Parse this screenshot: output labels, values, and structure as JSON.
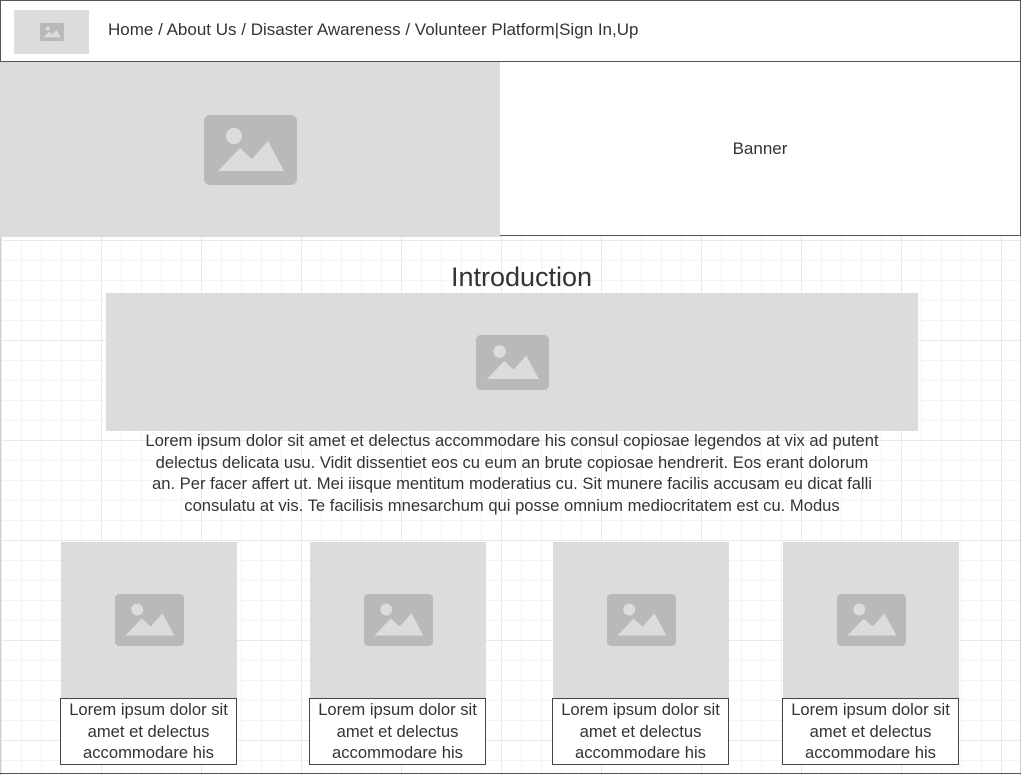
{
  "header": {
    "nav": {
      "home": "Home",
      "sep1": " / ",
      "about": "About Us",
      "sep2": " / ",
      "disaster": "Disaster Awareness",
      "sep3": " / ",
      "volunteer": "Volunteer Platform",
      "sep4": "|",
      "signin": "Sign In,Up"
    },
    "logo_icon": "image-placeholder-icon"
  },
  "banner": {
    "label": "Banner",
    "image_icon": "image-placeholder-icon"
  },
  "intro": {
    "title": "Introduction",
    "image_icon": "image-placeholder-icon",
    "lines": [
      "Lorem ipsum dolor sit amet et delectus accommodare his consul copiosae legendos at vix ad putent",
      "delectus delicata usu. Vidit dissentiet eos cu eum an brute copiosae hendrerit. Eos erant dolorum",
      "an. Per facer affert ut. Mei iisque mentitum moderatius cu. Sit munere facilis accusam eu dicat falli",
      "consulatu at vis. Te facilisis mnesarchum qui posse omnium mediocritatem est cu. Modus"
    ]
  },
  "cards": [
    {
      "line1": "Lorem ipsum dolor sit",
      "line2": "amet et delectus",
      "line3": "accommodare his"
    },
    {
      "line1": "Lorem ipsum dolor sit",
      "line2": "amet et delectus",
      "line3": "accommodare his"
    },
    {
      "line1": "Lorem ipsum dolor sit",
      "line2": "amet et delectus",
      "line3": "accommodare his"
    },
    {
      "line1": "Lorem ipsum dolor sit",
      "line2": "amet et delectus",
      "line3": "accommodare his"
    }
  ],
  "colors": {
    "placeholder_bg": "#dcdcdc",
    "placeholder_icon": "#b9b9b9",
    "text": "#333333",
    "border": "#555555"
  }
}
